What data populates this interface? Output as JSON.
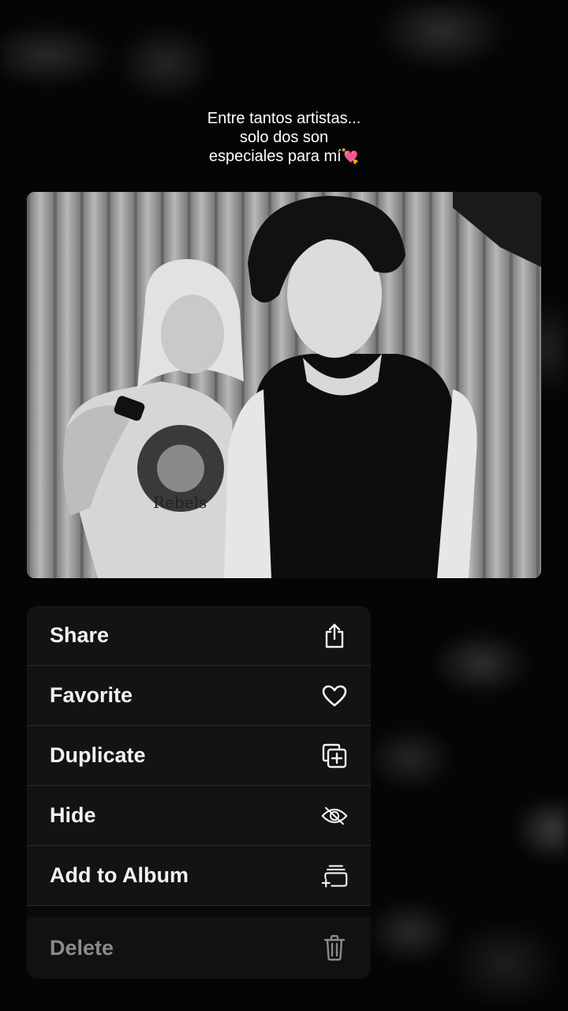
{
  "caption": {
    "line1": "Entre tantos artistas...",
    "line2": "solo dos son",
    "line3": "especiales para mí",
    "emoji": "💘"
  },
  "menu": {
    "items": [
      {
        "label": "Share",
        "icon": "share-icon"
      },
      {
        "label": "Favorite",
        "icon": "heart-icon"
      },
      {
        "label": "Duplicate",
        "icon": "duplicate-icon"
      },
      {
        "label": "Hide",
        "icon": "eye-slash-icon"
      },
      {
        "label": "Add to Album",
        "icon": "add-to-album-icon"
      }
    ],
    "delete": {
      "label": "Delete",
      "icon": "trash-icon"
    }
  },
  "photo": {
    "shirt_text": "Rebels"
  },
  "colors": {
    "menu_bg": "#131313",
    "menu_text": "#f2f2f2",
    "delete_text": "#8a8a8a",
    "background": "#050505"
  }
}
